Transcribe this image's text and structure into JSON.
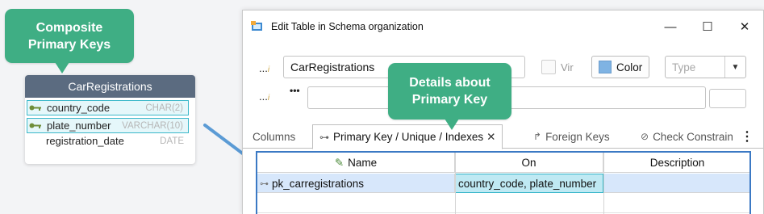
{
  "callouts": {
    "composite": "Composite Primary Keys",
    "details": "Details about Primary Key"
  },
  "diagram_table": {
    "title": "CarRegistrations",
    "rows": [
      {
        "name": "country_code",
        "type": "CHAR(2)",
        "primary_key": true
      },
      {
        "name": "plate_number",
        "type": "VARCHAR(10)",
        "primary_key": true
      },
      {
        "name": "registration_date",
        "type": "DATE",
        "primary_key": false
      }
    ]
  },
  "window": {
    "title": "Edit Table in Schema organization",
    "buttons": {
      "minimize": "—",
      "maximize": "☐",
      "close": "✕"
    },
    "name_value": "CarRegistrations",
    "virtual_label": "Vir",
    "color_label": "Color",
    "color_swatch": "#7fb3e3",
    "type_placeholder": "Type",
    "row_marker": "...",
    "comment_marker": "•••"
  },
  "tabs": [
    {
      "label": "Columns",
      "icon": "none"
    },
    {
      "label": "Primary Key / Unique / Indexes",
      "icon": "key-icon",
      "active": true,
      "close": "✕"
    },
    {
      "label": "Foreign Keys",
      "icon": "fk-arrow-icon"
    },
    {
      "label": "Check Constrain",
      "icon": "check-circle-icon"
    }
  ],
  "grid": {
    "headers": {
      "name": "Name",
      "on": "On",
      "description": "Description"
    },
    "rows": [
      {
        "name": "pk_carregistrations",
        "on": "country_code, plate_number",
        "description": ""
      }
    ]
  },
  "colors": {
    "callout": "#3fae84",
    "table_header": "#5b6b80",
    "selection": "#d7e7fb",
    "cell_highlight": "#bfe9f3",
    "accent_arrow": "#5b9bd5"
  }
}
